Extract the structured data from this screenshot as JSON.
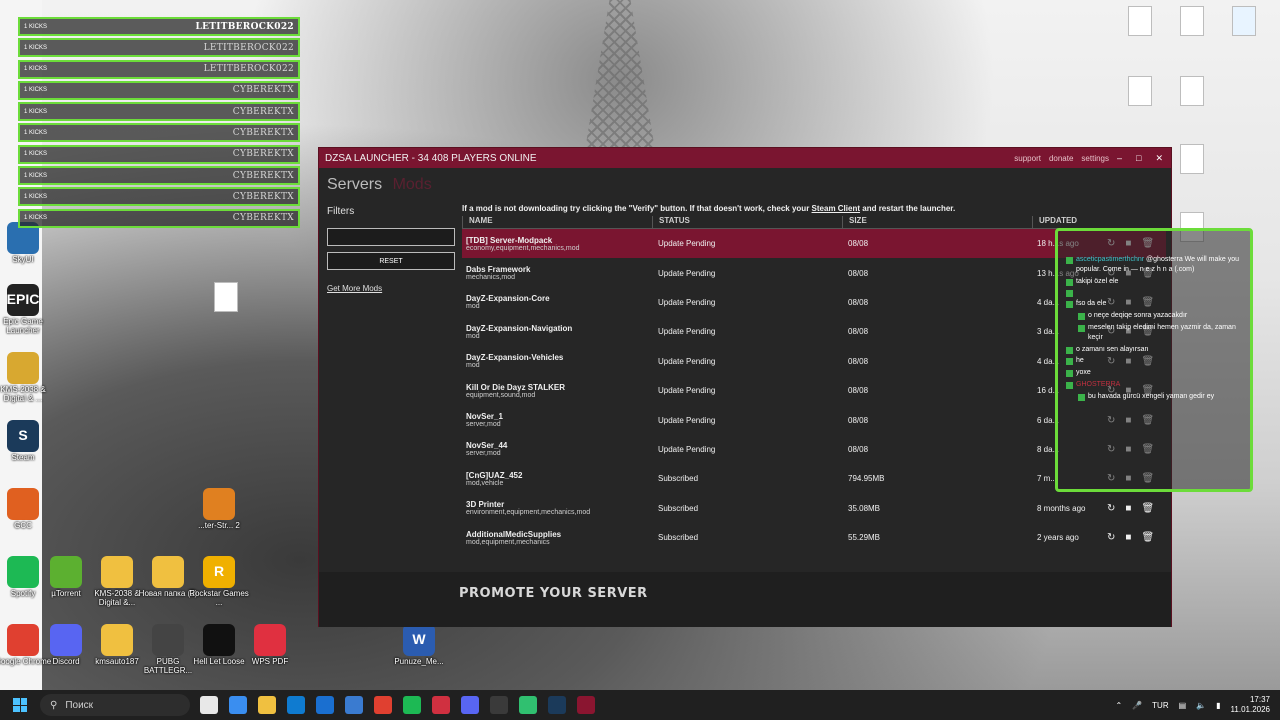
{
  "killfeed": [
    {
      "kicks": "1 KICKS",
      "name": "LETITBEROCK022"
    },
    {
      "kicks": "1 KICKS",
      "name": "LETITBEROCK022"
    },
    {
      "kicks": "1 KICKS",
      "name": "LETITBEROCK022"
    },
    {
      "kicks": "1 KICKS",
      "name": "CYBEREKTX"
    },
    {
      "kicks": "1 KICKS",
      "name": "CYBEREKTX"
    },
    {
      "kicks": "1 KICKS",
      "name": "CYBEREKTX"
    },
    {
      "kicks": "1 KICKS",
      "name": "CYBEREKTX"
    },
    {
      "kicks": "1 KICKS",
      "name": "CYBEREKTX"
    },
    {
      "kicks": "1 KICKS",
      "name": "CYBEREKTX"
    },
    {
      "kicks": "1 KICKS",
      "name": "CYBEREKTX"
    }
  ],
  "desktop_icons": [
    {
      "label": "SkyUI",
      "glyph": "",
      "color": "#2a6fb0"
    },
    {
      "label": "Epic Game Launcher",
      "glyph": "EPIC",
      "color": "#222222"
    },
    {
      "label": "KMS-2038 & Digital & ...",
      "glyph": "",
      "color": "#d8a830"
    },
    {
      "label": "Steam",
      "glyph": "S",
      "color": "#1b3a5a"
    },
    {
      "label": "GCC",
      "glyph": "",
      "color": "#e06020"
    },
    {
      "label": "Spotify",
      "glyph": "",
      "color": "#1db954"
    },
    {
      "label": "Google Chrome",
      "glyph": "",
      "color": "#e04030"
    },
    {
      "label": "Discord",
      "glyph": "",
      "color": "#5865f2"
    },
    {
      "label": "kmsauto187",
      "glyph": "",
      "color": "#f0c040"
    },
    {
      "label": "PUBG BATTLEGR...",
      "glyph": "",
      "color": "#444444"
    },
    {
      "label": "Hell Let Loose",
      "glyph": "",
      "color": "#111111"
    },
    {
      "label": "WPS PDF",
      "glyph": "",
      "color": "#e03040"
    },
    {
      "label": "µTorrent",
      "glyph": "",
      "color": "#5cb030"
    },
    {
      "label": "KMS-2038 & Digital &...",
      "glyph": "",
      "color": "#f0c040"
    },
    {
      "label": "Новая папка (3)",
      "glyph": "",
      "color": "#f0c040"
    },
    {
      "label": "Rockstar Games ...",
      "glyph": "R",
      "color": "#f0b000"
    },
    {
      "label": "Punuze_Me...",
      "glyph": "W",
      "color": "#2b5cb0"
    },
    {
      "label": "...ter-Str... 2",
      "glyph": "",
      "color": "#e08020"
    }
  ],
  "launcher": {
    "title": "DZSA LAUNCHER - 34 408 PLAYERS ONLINE",
    "menu": [
      "support",
      "donate",
      "settings"
    ],
    "tab_active": "Servers",
    "tab_inactive": "Mods",
    "notice_before": "If a mod is not downloading try clicking the \"Verify\" button. If that doesn't work, check your",
    "notice_link": "Steam Client",
    "notice_after": "and restart the launcher.",
    "filters_label": "Filters",
    "reset_label": "RESET",
    "get_more_mods": "Get More Mods",
    "columns": {
      "name": "NAME",
      "status": "STATUS",
      "size": "SIZE",
      "updated": "UPDATED"
    },
    "mods": [
      {
        "name": "[TDB] Server-Modpack",
        "tags": "economy,equipment,mechanics,mod",
        "status": "Update Pending",
        "size": "08/08",
        "updated": "18 h...s ago"
      },
      {
        "name": "Dabs Framework",
        "tags": "mechanics,mod",
        "status": "Update Pending",
        "size": "08/08",
        "updated": "13 h...s ago"
      },
      {
        "name": "DayZ-Expansion-Core",
        "tags": "mod",
        "status": "Update Pending",
        "size": "08/08",
        "updated": "4 da..."
      },
      {
        "name": "DayZ-Expansion-Navigation",
        "tags": "mod",
        "status": "Update Pending",
        "size": "08/08",
        "updated": "3 da..."
      },
      {
        "name": "DayZ-Expansion-Vehicles",
        "tags": "mod",
        "status": "Update Pending",
        "size": "08/08",
        "updated": "4 da..."
      },
      {
        "name": "Kill Or Die Dayz STALKER",
        "tags": "equipment,sound,mod",
        "status": "Update Pending",
        "size": "08/08",
        "updated": "16 d..."
      },
      {
        "name": "NovSer_1",
        "tags": "server,mod",
        "status": "Update Pending",
        "size": "08/08",
        "updated": "6 da..."
      },
      {
        "name": "NovSer_44",
        "tags": "server,mod",
        "status": "Update Pending",
        "size": "08/08",
        "updated": "8 da..."
      },
      {
        "name": "[CnG]UAZ_452",
        "tags": "mod,vehicle",
        "status": "Subscribed",
        "size": "794.95MB",
        "updated": "7 m..."
      },
      {
        "name": "3D Printer",
        "tags": "environment,equipment,mechanics,mod",
        "status": "Subscribed",
        "size": "35.08MB",
        "updated": "8 months ago"
      },
      {
        "name": "AdditionalMedicSupplies",
        "tags": "mod,equipment,mechanics",
        "status": "Subscribed",
        "size": "55.29MB",
        "updated": "2 years ago"
      }
    ],
    "promo_title": "PROMOTE YOUR SERVER"
  },
  "chat": [
    {
      "user": "asceticpastimerthchnr",
      "text": "@ghosterra We will make you popular. Come in — n e z h n a (.com)",
      "teal": true,
      "indent": false
    },
    {
      "user": "",
      "text": "takipi özel ele",
      "teal": false,
      "indent": false
    },
    {
      "user": "",
      "text": "",
      "teal": false,
      "indent": false
    },
    {
      "user": "",
      "text": "fso da ele",
      "teal": false,
      "indent": false
    },
    {
      "user": "",
      "text": "o neçe deqiqe sonra yazacakdır",
      "teal": false,
      "indent": true
    },
    {
      "user": "",
      "text": "meselen takip eledimi hemen yazmir da, zaman keçir",
      "teal": false,
      "indent": true
    },
    {
      "user": "",
      "text": "o zamanı sen alayırsan",
      "teal": false,
      "indent": false
    },
    {
      "user": "",
      "text": "he",
      "teal": false,
      "indent": false
    },
    {
      "user": "",
      "text": "yoxe",
      "teal": false,
      "indent": false
    },
    {
      "user": "GHOSTERRA",
      "text": "",
      "teal": false,
      "indent": false
    },
    {
      "user": "",
      "text": "bu havada gürcü xengeli yaman gedir ey",
      "teal": false,
      "indent": true
    }
  ],
  "taskbar": {
    "search_placeholder": "Поиск",
    "language": "TUR",
    "time": "17:37",
    "date": "11.01.2026",
    "apps": [
      "#e8e8e8",
      "#3a8ef0",
      "#f0c040",
      "#0f7bd0",
      "#1a6fd0",
      "#3a7bd0",
      "#e04030",
      "#1db954",
      "#d03040",
      "#5865f2",
      "#3a3a3a",
      "#30c070",
      "#1b3a5a",
      "#8a1530"
    ]
  }
}
